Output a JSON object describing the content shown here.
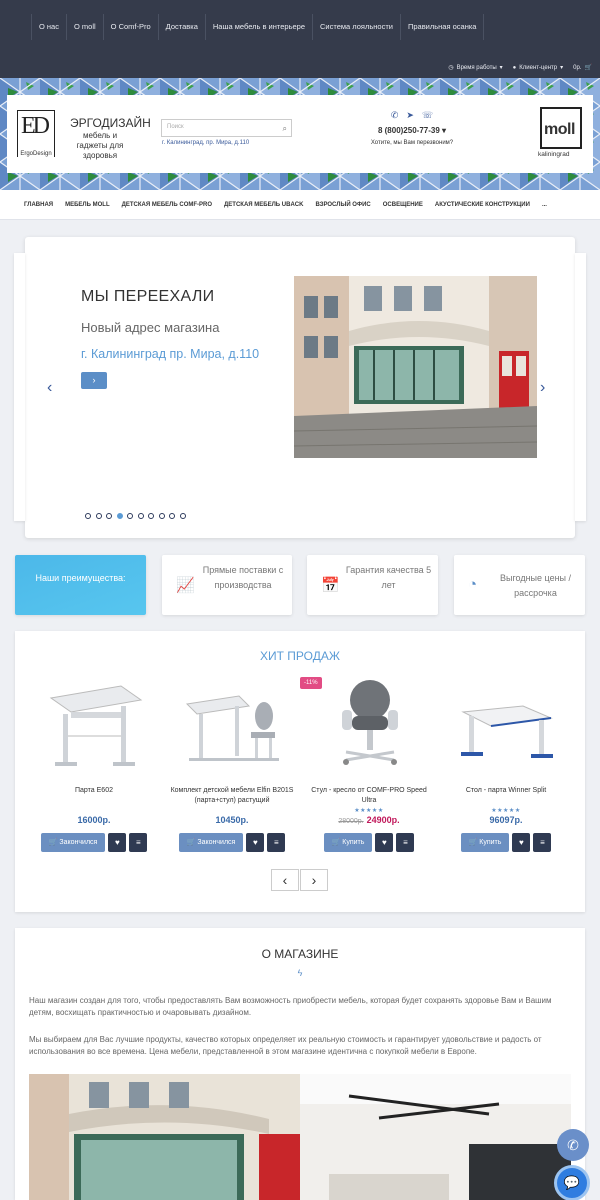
{
  "topnav": [
    "О нас",
    "О moll",
    "О Comf-Pro",
    "Доставка",
    "Наша мебель в интерьере",
    "Система лояльности",
    "Правильная осанка"
  ],
  "toputil": {
    "hours": "Время работы",
    "client": "Клиент-центр",
    "cart": "0р."
  },
  "header": {
    "logo_ed": "ED",
    "logo_ed_sub": "ErgoDesign",
    "brand_title": "ЭРГОДИЗАЙН",
    "brand_sub": "мебель и гаджеты для здоровья",
    "search_placeholder": "Поиск",
    "address": "г. Калининград, пр. Мира, д.110",
    "phone": "8 (800)250-77-39",
    "callback": "Хотите, мы Вам перезвоним?",
    "logo_moll": "moll",
    "logo_moll_sub": "kaliningrad"
  },
  "mainnav": [
    "ГЛАВНАЯ",
    "МЕБЕЛЬ MOLL",
    "ДЕТСКАЯ МЕБЕЛЬ COMF-PRO",
    "ДЕТСКАЯ МЕБЕЛЬ UBACK",
    "ВЗРОСЛЫЙ ОФИС",
    "ОСВЕЩЕНИЕ",
    "АКУСТИЧЕСКИЕ КОНСТРУКЦИИ",
    "..."
  ],
  "slider": {
    "title": "МЫ ПЕРЕЕХАЛИ",
    "subtitle": "Новый адрес магазина",
    "address": "г. Калининград пр. Мира, д.110",
    "dots_total": 10,
    "active_dot": 4
  },
  "advantages": {
    "heading": "Наши преимущества:",
    "items": [
      "Прямые поставки с производства",
      "Гарантия качества 5 лет",
      "Выгодные цены / рассрочка"
    ]
  },
  "hits": {
    "title": "ХИТ ПРОДАЖ",
    "products": [
      {
        "name": "Парта E602",
        "price": "16000р.",
        "button": "Закончился"
      },
      {
        "name": "Комплект детской мебели Elfin B201S (парта+стул) растущий",
        "price": "10450р.",
        "button": "Закончился"
      },
      {
        "name": "Стул - кресло от COMF-PRO Speed Ultra",
        "old_price": "28000р.",
        "price": "24900р.",
        "button": "Купить",
        "badge": "-11%",
        "rating": 5
      },
      {
        "name": "Стол - парта Winner Split",
        "price": "96097р.",
        "button": "Купить",
        "rating": 5
      }
    ]
  },
  "about": {
    "title": "О МАГАЗИНЕ",
    "p1": "Наш магазин создан для того, чтобы предоставлять Вам возможность приобрести мебель, которая будет сохранять здоровье Вам и Вашим детям, восхищать практичностью и очаровывать дизайном.",
    "p2": "Мы выбираем для Вас лучшие продукты, качество которых определяет их реальную стоимость и гарантирует удовольствие и радость от использования во все времена. Цена мебели, представленной в этом магазине идентична с покупкой мебели в Европе."
  },
  "colors": {
    "topbar": "#353b4b",
    "accent": "#5b9bd5",
    "button": "#6b8fc1",
    "sale": "#c1185b"
  }
}
